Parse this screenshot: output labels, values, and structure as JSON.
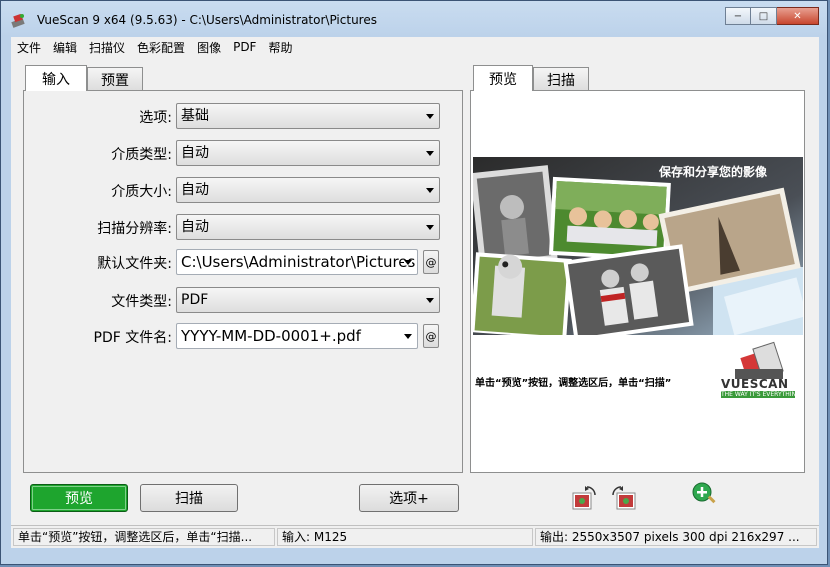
{
  "window": {
    "title": "VueScan 9 x64 (9.5.63) - C:\\Users\\Administrator\\Pictures",
    "controls": {
      "minimize": "−",
      "maximize": "□",
      "close": "✕"
    }
  },
  "menu": [
    "文件",
    "编辑",
    "扫描仪",
    "色彩配置",
    "图像",
    "PDF",
    "帮助"
  ],
  "left_tabs": {
    "input": "输入",
    "prefs": "预置"
  },
  "form": {
    "options_label": "选项:",
    "options_value": "基础",
    "media_type_label": "介质类型:",
    "media_type_value": "自动",
    "media_size_label": "介质大小:",
    "media_size_value": "自动",
    "scan_res_label": "扫描分辨率:",
    "scan_res_value": "自动",
    "default_folder_label": "默认文件夹:",
    "default_folder_value": "C:\\Users\\Administrator\\Pictures",
    "file_type_label": "文件类型:",
    "file_type_value": "PDF",
    "pdf_name_label": "PDF 文件名:",
    "pdf_name_value": "YYYY-MM-DD-0001+.pdf",
    "at_symbol": "@"
  },
  "right_tabs": {
    "preview": "预览",
    "scan": "扫描"
  },
  "preview": {
    "banner": "保存和分享您的影像",
    "hint": "单击“预览”按钮，调整选区后，单击“扫描”",
    "logo_text": "VUESCAN",
    "logo_tag": "THE WAY IT'S EVERYTHING"
  },
  "buttons": {
    "preview": "预览",
    "scan": "扫描",
    "options_plus": "选项+"
  },
  "status": {
    "hint": "单击“预览”按钮，调整选区后，单击“扫描...",
    "input": "输入: M125",
    "output": "输出: 2550x3507 pixels 300 dpi 216x297 ..."
  },
  "colors": {
    "green_button": "#1ea52e",
    "titlebar": "#bcd2ea"
  }
}
